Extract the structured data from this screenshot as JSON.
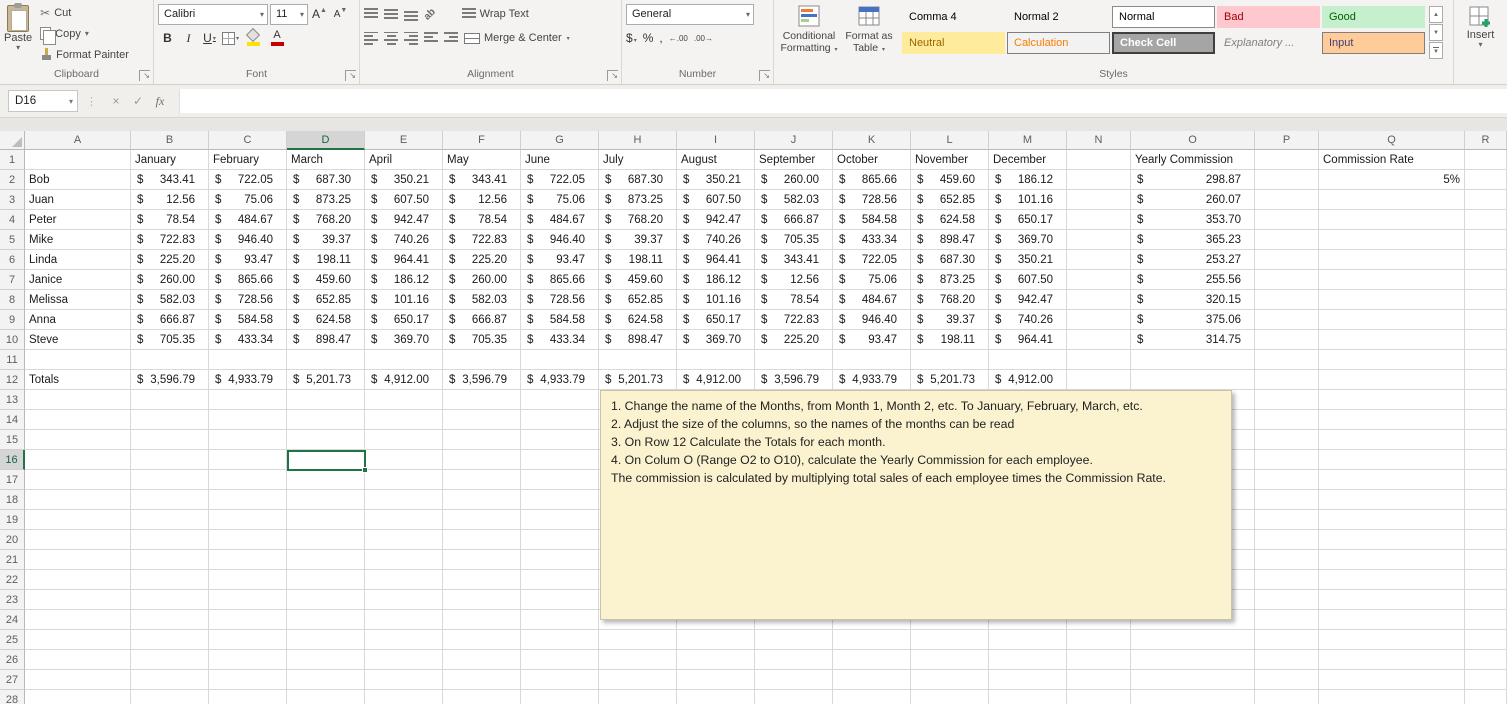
{
  "ui_colors": {
    "selection_green": "#217346",
    "note_bg": "#FBF2D0",
    "fill_swatch": "#FFE100",
    "font_color_swatch": "#C00000"
  },
  "icons": {
    "dropdown": "▾",
    "cut": "✂",
    "dialog_launcher": "↘",
    "separator_dots": "⋮",
    "cancel": "×",
    "enter": "✓",
    "fx": "fx",
    "bold": "B",
    "italic": "I",
    "underline": "U",
    "font_letter": "A",
    "up_arrow": "▲",
    "down_arrow": "▼",
    "orientation": "ab",
    "dollar": "$",
    "percent": "%",
    "comma": ",",
    "increase_decimal": "←.00",
    "decrease_decimal": ".00→"
  },
  "ribbon": {
    "clipboard": {
      "label": "Clipboard",
      "paste": "Paste",
      "cut": "Cut",
      "copy": "Copy",
      "format_painter": "Format Painter"
    },
    "font": {
      "label": "Font",
      "family": "Calibri",
      "size": "11"
    },
    "alignment": {
      "label": "Alignment",
      "wrap_text": "Wrap Text",
      "merge_center": "Merge & Center"
    },
    "number": {
      "label": "Number",
      "format": "General"
    },
    "styles": {
      "label": "Styles",
      "conditional_line1": "Conditional",
      "conditional_line2": "Formatting",
      "format_table_line1": "Format as",
      "format_table_line2": "Table",
      "gallery": [
        {
          "name": "Comma 4"
        },
        {
          "name": "Normal 2"
        },
        {
          "name": "Normal"
        },
        {
          "name": "Bad"
        },
        {
          "name": "Good"
        },
        {
          "name": "Neutral"
        },
        {
          "name": "Calculation"
        },
        {
          "name": "Check Cell"
        },
        {
          "name": "Explanatory ..."
        },
        {
          "name": "Input"
        }
      ]
    },
    "cells": {
      "insert": "Insert"
    }
  },
  "formula_bar": {
    "name_box": "D16",
    "formula": ""
  },
  "sheet": {
    "columns": [
      "A",
      "B",
      "C",
      "D",
      "E",
      "F",
      "G",
      "H",
      "I",
      "J",
      "K",
      "L",
      "M",
      "N",
      "O",
      "P",
      "Q",
      "R"
    ],
    "row_count": 28,
    "selected_cell": {
      "col": "D",
      "row": 16
    },
    "currency_symbol": "$",
    "month_headers": [
      "January",
      "February",
      "March",
      "April",
      "May",
      "June",
      "July",
      "August",
      "September",
      "October",
      "November",
      "December"
    ],
    "yearly_commission_header": "Yearly Commission",
    "commission_rate_header": "Commission Rate",
    "commission_rate_value": "5%",
    "employees": [
      {
        "name": "Bob",
        "sales": [
          "343.41",
          "722.05",
          "687.30",
          "350.21",
          "343.41",
          "722.05",
          "687.30",
          "350.21",
          "260.00",
          "865.66",
          "459.60",
          "186.12"
        ],
        "yearly": "298.87"
      },
      {
        "name": "Juan",
        "sales": [
          "12.56",
          "75.06",
          "873.25",
          "607.50",
          "12.56",
          "75.06",
          "873.25",
          "607.50",
          "582.03",
          "728.56",
          "652.85",
          "101.16"
        ],
        "yearly": "260.07"
      },
      {
        "name": "Peter",
        "sales": [
          "78.54",
          "484.67",
          "768.20",
          "942.47",
          "78.54",
          "484.67",
          "768.20",
          "942.47",
          "666.87",
          "584.58",
          "624.58",
          "650.17"
        ],
        "yearly": "353.70"
      },
      {
        "name": "Mike",
        "sales": [
          "722.83",
          "946.40",
          "39.37",
          "740.26",
          "722.83",
          "946.40",
          "39.37",
          "740.26",
          "705.35",
          "433.34",
          "898.47",
          "369.70"
        ],
        "yearly": "365.23"
      },
      {
        "name": "Linda",
        "sales": [
          "225.20",
          "93.47",
          "198.11",
          "964.41",
          "225.20",
          "93.47",
          "198.11",
          "964.41",
          "343.41",
          "722.05",
          "687.30",
          "350.21"
        ],
        "yearly": "253.27"
      },
      {
        "name": "Janice",
        "sales": [
          "260.00",
          "865.66",
          "459.60",
          "186.12",
          "260.00",
          "865.66",
          "459.60",
          "186.12",
          "12.56",
          "75.06",
          "873.25",
          "607.50"
        ],
        "yearly": "255.56"
      },
      {
        "name": "Melissa",
        "sales": [
          "582.03",
          "728.56",
          "652.85",
          "101.16",
          "582.03",
          "728.56",
          "652.85",
          "101.16",
          "78.54",
          "484.67",
          "768.20",
          "942.47"
        ],
        "yearly": "320.15"
      },
      {
        "name": "Anna",
        "sales": [
          "666.87",
          "584.58",
          "624.58",
          "650.17",
          "666.87",
          "584.58",
          "624.58",
          "650.17",
          "722.83",
          "946.40",
          "39.37",
          "740.26"
        ],
        "yearly": "375.06"
      },
      {
        "name": "Steve",
        "sales": [
          "705.35",
          "433.34",
          "898.47",
          "369.70",
          "705.35",
          "433.34",
          "898.47",
          "369.70",
          "225.20",
          "93.47",
          "198.11",
          "964.41"
        ],
        "yearly": "314.75"
      }
    ],
    "totals_label": "Totals",
    "totals": [
      "3,596.79",
      "4,933.79",
      "5,201.73",
      "4,912.00",
      "3,596.79",
      "4,933.79",
      "5,201.73",
      "4,912.00",
      "3,596.79",
      "4,933.79",
      "5,201.73",
      "4,912.00"
    ],
    "note_lines": [
      "1. Change the name of the Months, from Month 1, Month 2, etc.  To January, February, March, etc.",
      "2. Adjust the size of the columns, so the names of the months can be read",
      "3. On Row 12 Calculate the Totals for each month.",
      "4. On Colum O (Range O2 to O10), calculate the Yearly Commission for each employee.",
      "The commission is calculated by multiplying total sales of each employee times the Commission Rate."
    ]
  }
}
